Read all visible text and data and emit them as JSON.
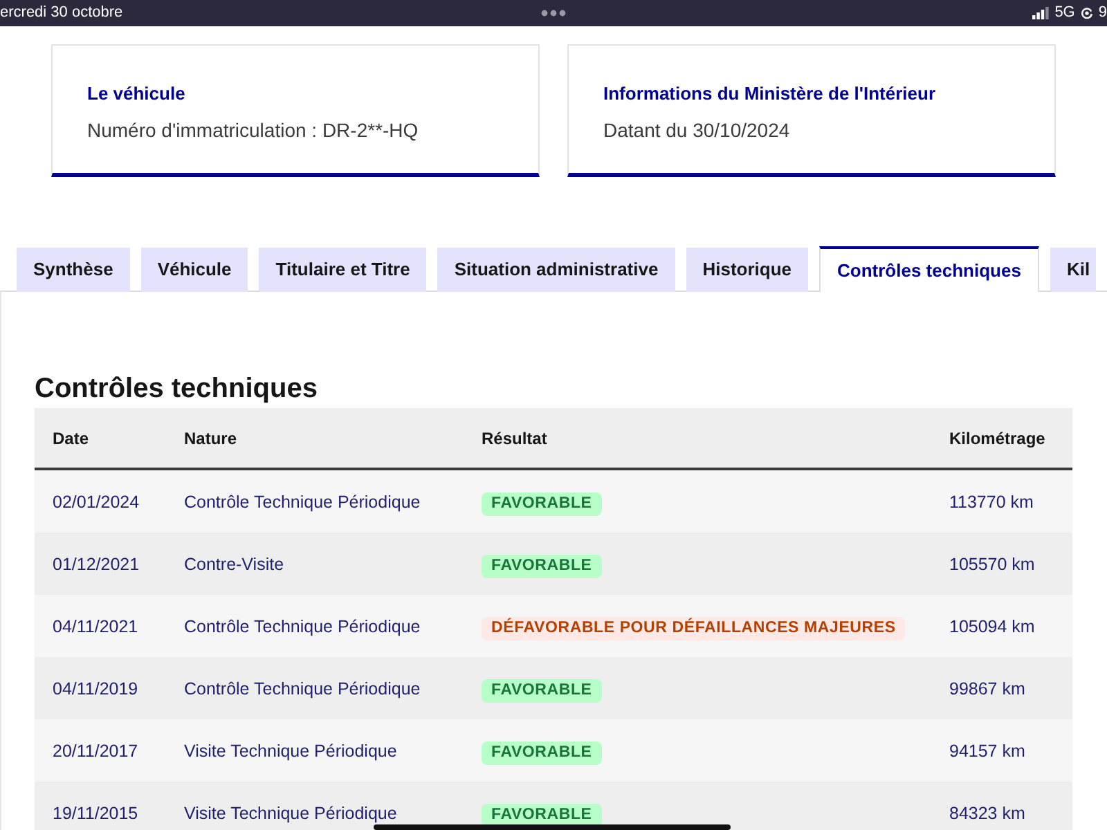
{
  "status_bar": {
    "date": "ercredi 30 octobre",
    "network": "5G",
    "edge_text": "9"
  },
  "cards": [
    {
      "title": "Le véhicule",
      "text": "Numéro d'immatriculation : DR-2**-HQ"
    },
    {
      "title": "Informations du Ministère de l'Intérieur",
      "text": "Datant du 30/10/2024"
    }
  ],
  "tabs": [
    {
      "label": "Synthèse",
      "selected": false
    },
    {
      "label": "Véhicule",
      "selected": false
    },
    {
      "label": "Titulaire et Titre",
      "selected": false
    },
    {
      "label": "Situation administrative",
      "selected": false
    },
    {
      "label": "Historique",
      "selected": false
    },
    {
      "label": "Contrôles techniques",
      "selected": true
    },
    {
      "label": "Kil",
      "selected": false
    }
  ],
  "section": {
    "title": "Contrôles techniques"
  },
  "table": {
    "columns": [
      "Date",
      "Nature",
      "Résultat",
      "Kilométrage"
    ],
    "rows": [
      {
        "date": "02/01/2024",
        "nature": "Contrôle Technique Périodique",
        "result": {
          "label": "FAVORABLE",
          "kind": "success"
        },
        "mileage": "113770 km"
      },
      {
        "date": "01/12/2021",
        "nature": "Contre-Visite",
        "result": {
          "label": "FAVORABLE",
          "kind": "success"
        },
        "mileage": "105570 km"
      },
      {
        "date": "04/11/2021",
        "nature": "Contrôle Technique Périodique",
        "result": {
          "label": "DÉFAVORABLE POUR DÉFAILLANCES MAJEURES",
          "kind": "error"
        },
        "mileage": "105094 km"
      },
      {
        "date": "04/11/2019",
        "nature": "Contrôle Technique Périodique",
        "result": {
          "label": "FAVORABLE",
          "kind": "success"
        },
        "mileage": "99867 km"
      },
      {
        "date": "20/11/2017",
        "nature": "Visite Technique Périodique",
        "result": {
          "label": "FAVORABLE",
          "kind": "success"
        },
        "mileage": "94157 km"
      },
      {
        "date": "19/11/2015",
        "nature": "Visite Technique Périodique",
        "result": {
          "label": "FAVORABLE",
          "kind": "success"
        },
        "mileage": "84323 km"
      }
    ]
  }
}
